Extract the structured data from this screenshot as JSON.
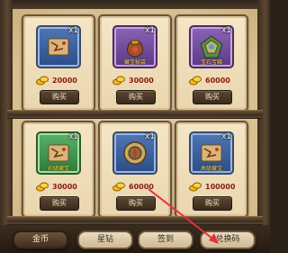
{
  "shop": {
    "buy_label": "购买",
    "items": [
      {
        "icon": "scroll-map-icon",
        "qty": "x1",
        "price": "20000",
        "frame": "blue",
        "label": ""
      },
      {
        "icon": "treasure-bag-icon",
        "qty": "x1",
        "price": "30000",
        "frame": "purple",
        "label": "藏宝秘袋"
      },
      {
        "icon": "gem-box-icon",
        "qty": "x1",
        "price": "60000",
        "frame": "purple",
        "label": "宝石宝箱"
      },
      {
        "icon": "scroll-map-icon",
        "qty": "x1",
        "price": "30000",
        "frame": "green",
        "label": "初级藏宝"
      },
      {
        "icon": "compass-chest-icon",
        "qty": "x1",
        "price": "60000",
        "frame": "blue",
        "label": ""
      },
      {
        "icon": "scroll-map-icon",
        "qty": "x1",
        "price": "100000",
        "frame": "blue",
        "label": "高级藏宝"
      }
    ]
  },
  "tabs": [
    {
      "label": "金币",
      "active": true
    },
    {
      "label": "星钻",
      "active": false
    },
    {
      "label": "签到",
      "active": false
    },
    {
      "label": "兑换码",
      "active": false
    }
  ],
  "colors": {
    "price_text": "#8a1a12",
    "annotation_arrow": "#e8303a"
  }
}
